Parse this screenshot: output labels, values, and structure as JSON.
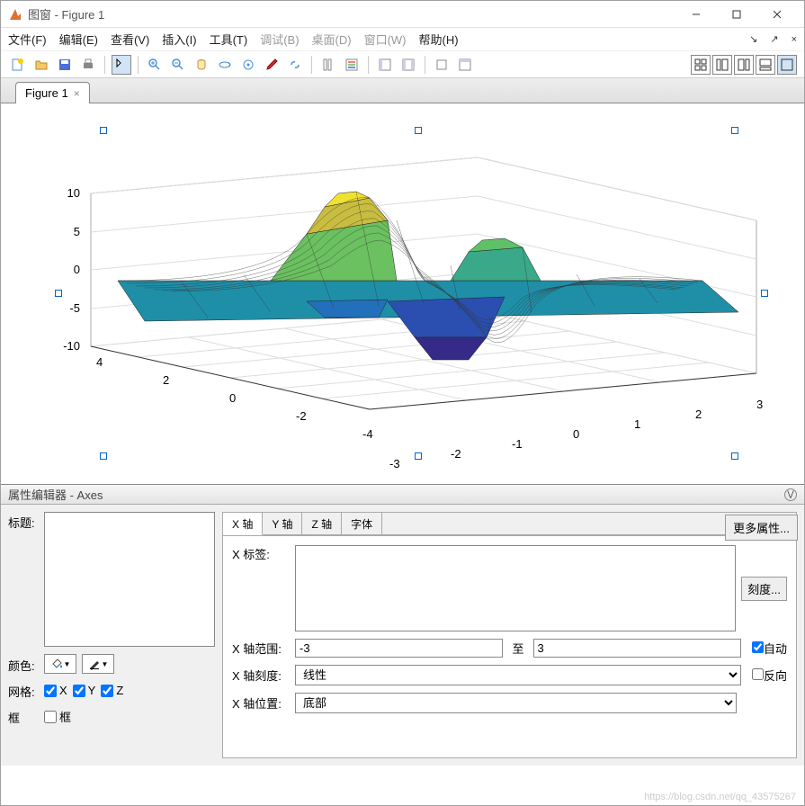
{
  "window": {
    "title": "图窗 - Figure 1"
  },
  "menu": {
    "file": "文件(F)",
    "edit": "编辑(E)",
    "view": "查看(V)",
    "insert": "插入(I)",
    "tools": "工具(T)",
    "debug": "调试(B)",
    "desktop": "桌面(D)",
    "window": "窗口(W)",
    "help": "帮助(H)"
  },
  "tab": {
    "label": "Figure 1"
  },
  "chart_data": {
    "type": "surface",
    "title": "",
    "xrange": [
      -3,
      3
    ],
    "yrange": [
      -4,
      4
    ],
    "zrange": [
      -10,
      10
    ],
    "xticks": [
      -3,
      -2,
      -1,
      0,
      1,
      2,
      3
    ],
    "yticks": [
      -4,
      -2,
      0,
      2,
      4
    ],
    "zticks": [
      -10,
      -5,
      0,
      5,
      10
    ],
    "description": "3D surface plot of peaks-like function over meshgrid x∈[-3,3], y∈[-4,4]"
  },
  "zticks": {
    "a": "10",
    "b": "5",
    "c": "0",
    "d": "-5",
    "e": "-10"
  },
  "yticks": {
    "a": "4",
    "b": "2",
    "c": "0",
    "d": "-2",
    "e": "-4"
  },
  "xticks": {
    "a": "-3",
    "b": "-2",
    "c": "-1",
    "d": "0",
    "e": "1",
    "f": "2",
    "g": "3"
  },
  "propeditor": {
    "title": "属性编辑器 - Axes"
  },
  "labels": {
    "title": "标题:",
    "color": "颜色:",
    "grid": "网格:",
    "box": "框",
    "X": "X",
    "Y": "Y",
    "Z": "Z"
  },
  "axistabs": {
    "x": "X 轴",
    "y": "Y 轴",
    "z": "Z 轴",
    "font": "字体"
  },
  "axis": {
    "xlabel": "X 标签:",
    "range": "X 轴范围:",
    "to": "至",
    "rmin": "-3",
    "rmax": "3",
    "auto": "自动",
    "scale": "X 轴刻度:",
    "scaleval": "线性",
    "reverse": "反向",
    "location": "X 轴位置:",
    "locval": "底部",
    "ticks": "刻度...",
    "more": "更多属性..."
  },
  "watermark": "https://blog.csdn.net/qq_43575267"
}
